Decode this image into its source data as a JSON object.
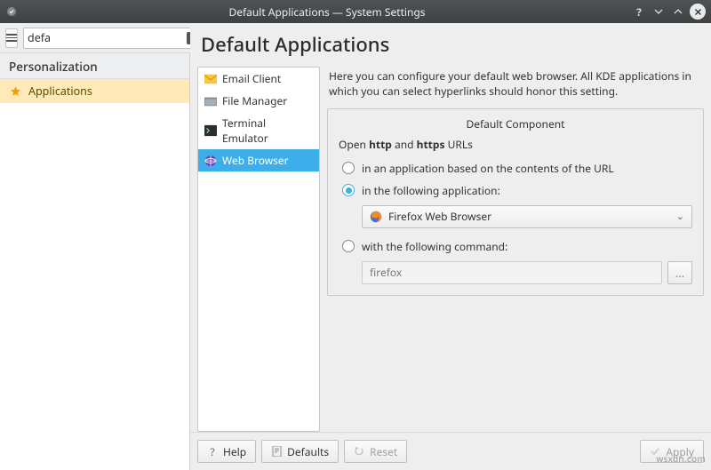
{
  "titlebar": {
    "title": "Default Applications — System Settings"
  },
  "search": {
    "value": "defa"
  },
  "sidebar": {
    "section": "Personalization",
    "items": [
      "Applications"
    ],
    "active_index": 0
  },
  "main": {
    "heading": "Default Applications",
    "categories": [
      {
        "icon": "mail-icon",
        "label": "Email Client"
      },
      {
        "icon": "folder-icon",
        "label": "File Manager"
      },
      {
        "icon": "terminal-icon",
        "label": "Terminal Emulator"
      },
      {
        "icon": "globe-icon",
        "label": "Web Browser"
      }
    ],
    "selected_category_index": 3,
    "description": "Here you can configure your default web browser. All KDE applications in which you can select hyperlinks should honor this setting.",
    "group": {
      "legend": "Default Component",
      "open_prefix": "Open ",
      "open_proto1": "http",
      "open_mid": " and ",
      "open_proto2": "https",
      "open_suffix": " URLs",
      "radios": {
        "r0": "in an application based on the contents of the URL",
        "r1": "in the following application:",
        "r2": "with the following command:",
        "selected": 1
      },
      "combo": {
        "label": "Firefox Web Browser"
      },
      "command": {
        "placeholder": "firefox",
        "browse": "..."
      }
    }
  },
  "buttons": {
    "help": "Help",
    "defaults": "Defaults",
    "reset": "Reset",
    "apply": "Apply"
  },
  "watermark": "wsxdn.com"
}
